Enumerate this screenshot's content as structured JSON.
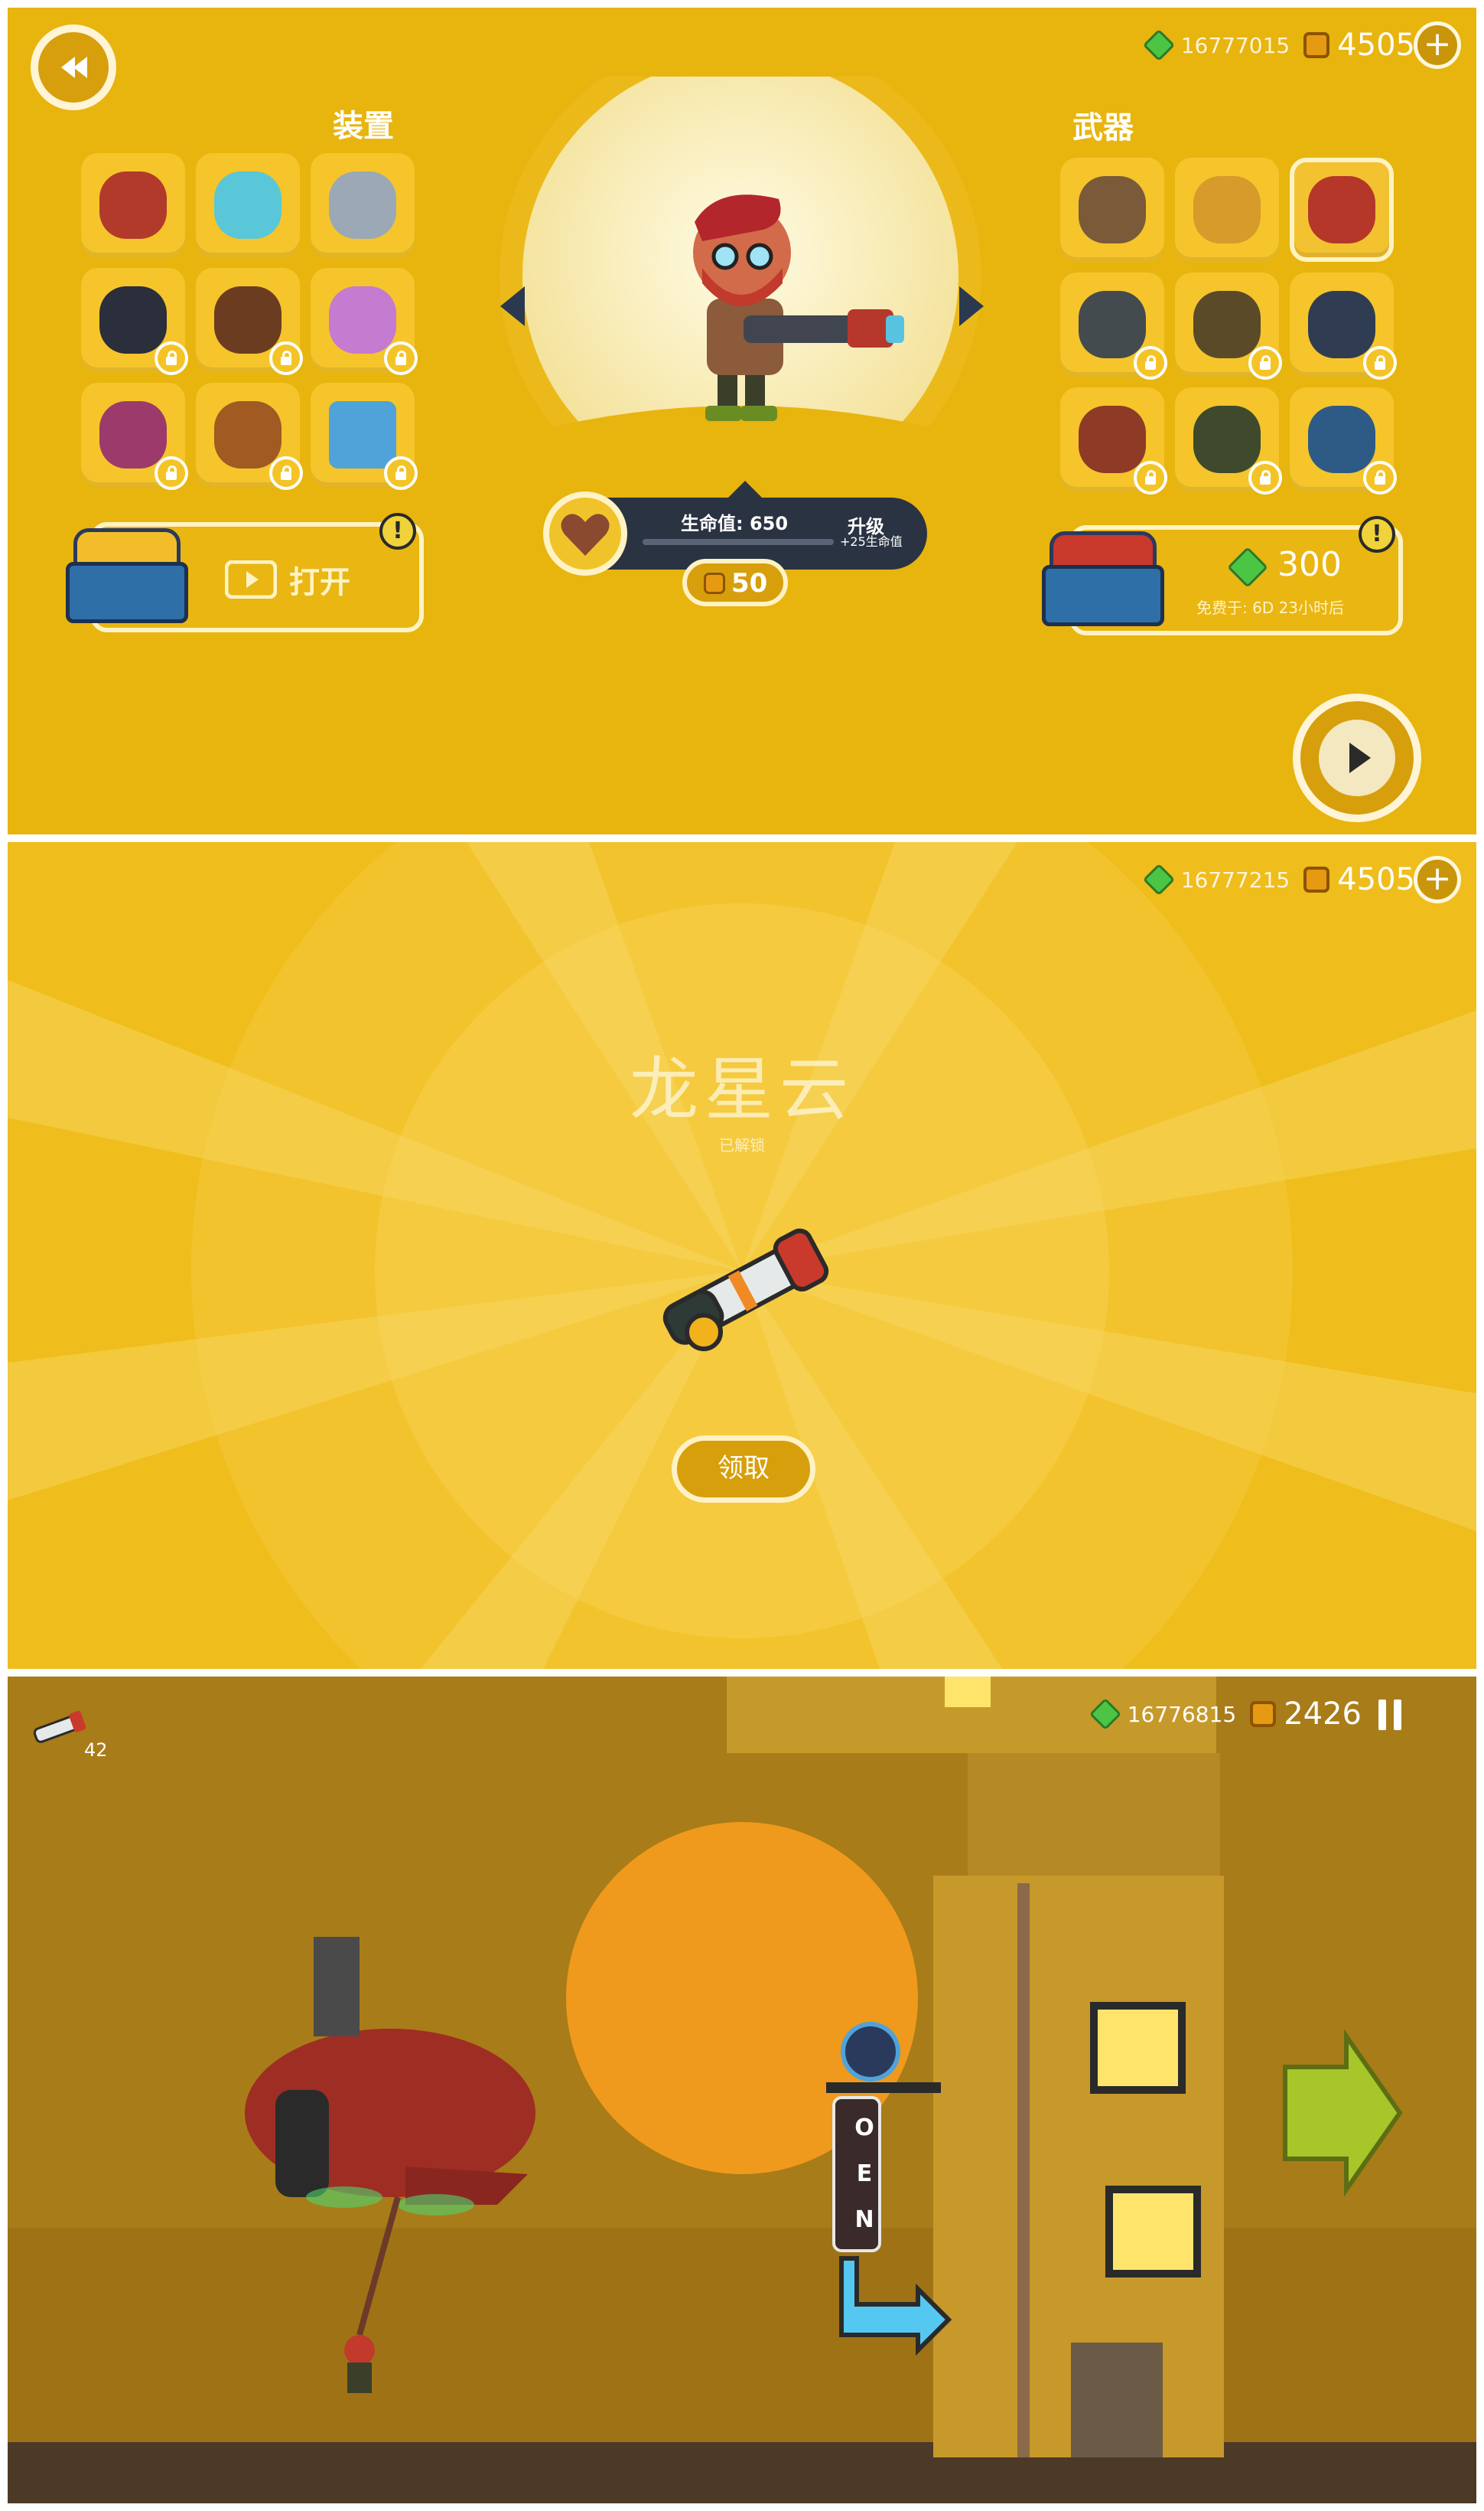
{
  "loadout": {
    "gems": "16777015",
    "coins": "4505",
    "equipment_title": "装置",
    "weapons_title": "武器",
    "open_label": "打开",
    "hp_label": "生命值: 650",
    "upgrade_label": "升级",
    "upgrade_bonus": "+25生命值",
    "upgrade_cost": "50",
    "gem_offer": "300",
    "free_in": "免费于:  6D 23小时后"
  },
  "reward": {
    "gems": "16777215",
    "coins": "4505",
    "weapon_name": "龙星云",
    "status": "已解锁",
    "claim_label": "领取"
  },
  "gameplay": {
    "ammo": "42",
    "gems": "16776815",
    "coins": "2426",
    "sign_letters": [
      "O",
      "E",
      "N"
    ]
  },
  "colors": {
    "panel_bg": "#e8b40e",
    "gem": "#4cc545",
    "coin": "#e69a12"
  }
}
